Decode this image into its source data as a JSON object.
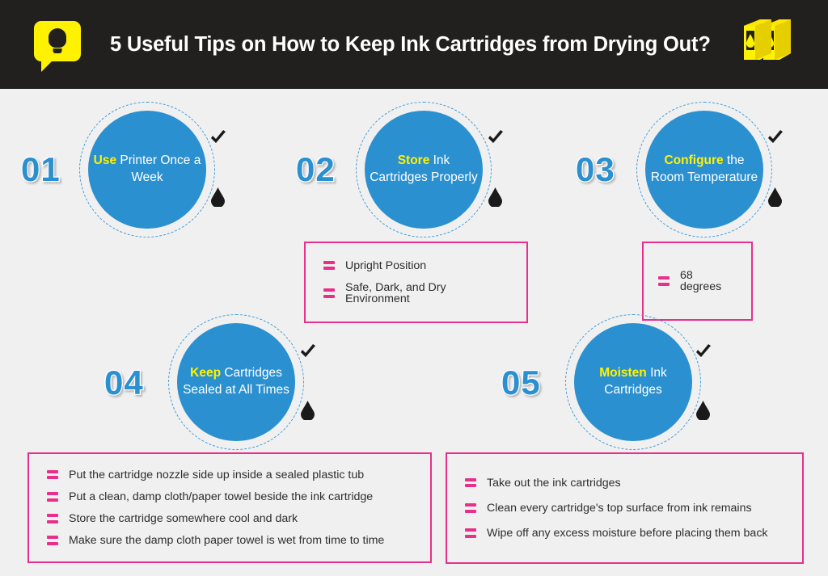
{
  "header": {
    "title": "5 Useful Tips on How to Keep Ink Cartridges from Drying Out?",
    "logo_icon": "lightbulb-speech-bubble-icon",
    "right_icon": "ink-cartridges-icon",
    "background_color": "#221f1f",
    "accent_color": "#fff200"
  },
  "theme": {
    "page_background": "#f0f0f0",
    "circle_blue": "#2b90d0",
    "highlight_yellow": "#fff200",
    "box_pink": "#e8308a",
    "text_dark": "#302d2d"
  },
  "steps": [
    {
      "number": "01",
      "keyword": "Use",
      "rest": " Printer Once a Week",
      "check_icon": "checkmark-icon",
      "drop_icon": "ink-drop-icon",
      "details": []
    },
    {
      "number": "02",
      "keyword": "Store",
      "rest": " Ink Cartridges Properly",
      "check_icon": "checkmark-icon",
      "drop_icon": "ink-drop-icon",
      "details": [
        "Upright Position",
        "Safe, Dark, and Dry Environment"
      ]
    },
    {
      "number": "03",
      "keyword": "Configure",
      "rest": " the Room Temperature",
      "check_icon": "checkmark-icon",
      "drop_icon": "ink-drop-icon",
      "details": [
        "68 degrees"
      ]
    },
    {
      "number": "04",
      "keyword": "Keep",
      "rest": " Cartridges Sealed at All Times",
      "check_icon": "checkmark-icon",
      "drop_icon": "ink-drop-icon",
      "details": [
        "Put the cartridge nozzle side up inside a sealed plastic tub",
        "Put a clean, damp cloth/paper towel beside the ink cartridge",
        "Store the cartridge somewhere cool and dark",
        "Make sure the damp cloth paper towel is wet from time to time"
      ]
    },
    {
      "number": "05",
      "keyword": "Moisten",
      "rest": " Ink Cartridges",
      "check_icon": "checkmark-icon",
      "drop_icon": "ink-drop-icon",
      "details": [
        "Take out the ink cartridges",
        "Clean every cartridge's top surface from ink remains",
        "Wipe off any excess moisture before placing them back"
      ]
    }
  ]
}
